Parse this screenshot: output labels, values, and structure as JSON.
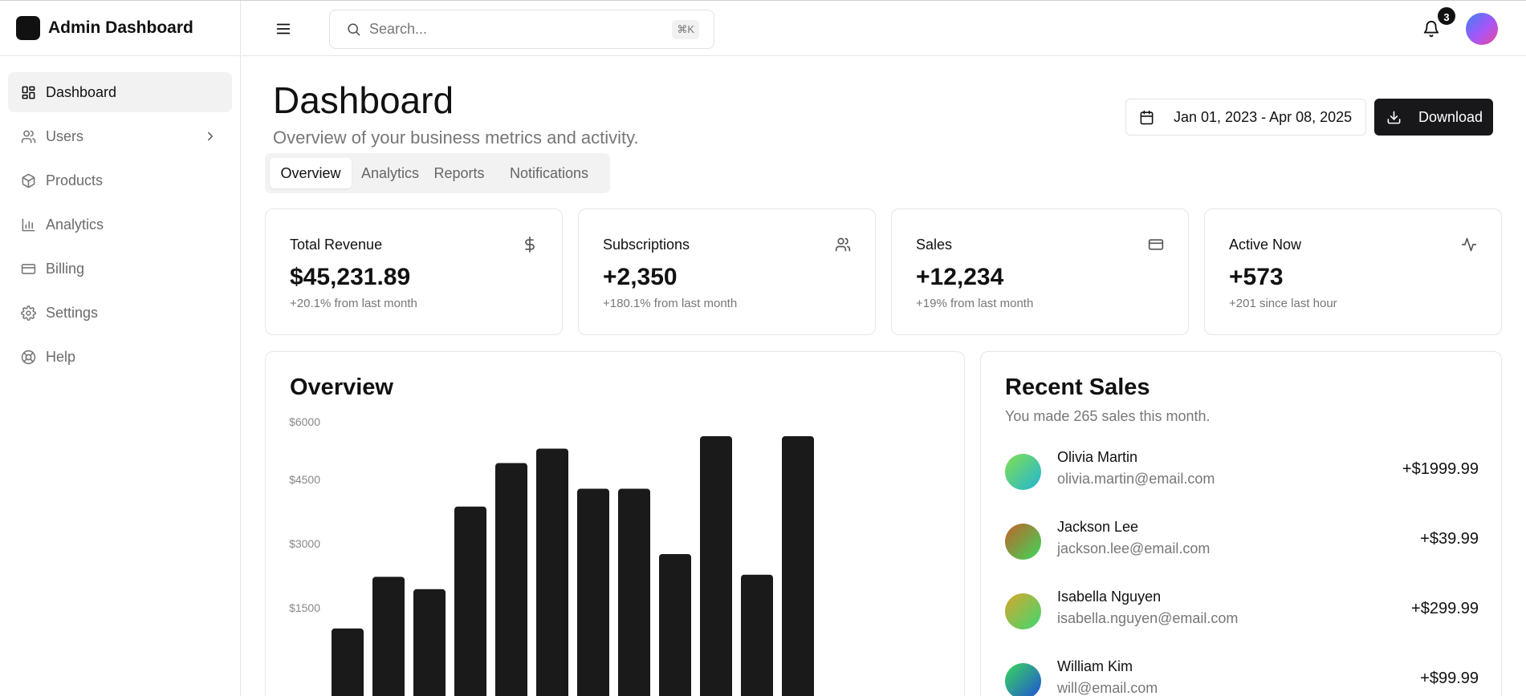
{
  "app": {
    "name": "Admin Dashboard"
  },
  "sidebar": {
    "items": [
      {
        "label": "Dashboard",
        "icon": "layout-dashboard-icon",
        "active": true
      },
      {
        "label": "Users",
        "icon": "users-icon",
        "has_chevron": true
      },
      {
        "label": "Products",
        "icon": "package-icon"
      },
      {
        "label": "Analytics",
        "icon": "bar-chart-icon"
      },
      {
        "label": "Billing",
        "icon": "credit-card-icon"
      },
      {
        "label": "Settings",
        "icon": "gear-icon"
      },
      {
        "label": "Help",
        "icon": "life-buoy-icon"
      }
    ]
  },
  "header": {
    "search_placeholder": "Search...",
    "search_shortcut": "⌘K",
    "notification_count": "3"
  },
  "page": {
    "title": "Dashboard",
    "subtitle": "Overview of your business metrics and activity.",
    "date_range": "Jan 01, 2023 - Apr 08, 2025",
    "download_label": "Download"
  },
  "tabs": [
    {
      "label": "Overview",
      "active": true
    },
    {
      "label": "Analytics"
    },
    {
      "label": "Reports"
    },
    {
      "label": "Notifications"
    }
  ],
  "stats": [
    {
      "title": "Total Revenue",
      "value": "$45,231.89",
      "delta": "+20.1% from last month",
      "icon": "dollar-icon"
    },
    {
      "title": "Subscriptions",
      "value": "+2,350",
      "delta": "+180.1% from last month",
      "icon": "users-icon"
    },
    {
      "title": "Sales",
      "value": "+12,234",
      "delta": "+19% from last month",
      "icon": "credit-card-icon"
    },
    {
      "title": "Active Now",
      "value": "+573",
      "delta": "+201 since last hour",
      "icon": "activity-icon"
    }
  ],
  "overview": {
    "title": "Overview"
  },
  "chart_data": {
    "type": "bar",
    "title": "Overview",
    "xlabel": "",
    "ylabel": "",
    "ylim": [
      0,
      6000
    ],
    "yticks": [
      "$6000",
      "$4500",
      "$3000",
      "$1500"
    ],
    "ytick_values": [
      6000,
      4500,
      3000,
      1500
    ],
    "values": [
      1000,
      2250,
      1950,
      3950,
      5000,
      5350,
      4380,
      4380,
      2800,
      5650,
      2300,
      5650
    ],
    "bar_color": "#1a1a1a",
    "grid": false
  },
  "recent_sales": {
    "title": "Recent Sales",
    "subtitle": "You made 265 sales this month.",
    "items": [
      {
        "name": "Olivia Martin",
        "email": "olivia.martin@email.com",
        "amount": "+$1999.99",
        "gradient": [
          "#84e04f",
          "#1fb5d6"
        ]
      },
      {
        "name": "Jackson Lee",
        "email": "jackson.lee@email.com",
        "amount": "+$39.99",
        "gradient": [
          "#c2622a",
          "#3ad85a"
        ]
      },
      {
        "name": "Isabella Nguyen",
        "email": "isabella.nguyen@email.com",
        "amount": "+$299.99",
        "gradient": [
          "#d9a72a",
          "#3bd873"
        ]
      },
      {
        "name": "William Kim",
        "email": "will@email.com",
        "amount": "+$99.99",
        "gradient": [
          "#3bd85a",
          "#1e4fd8"
        ]
      }
    ]
  }
}
